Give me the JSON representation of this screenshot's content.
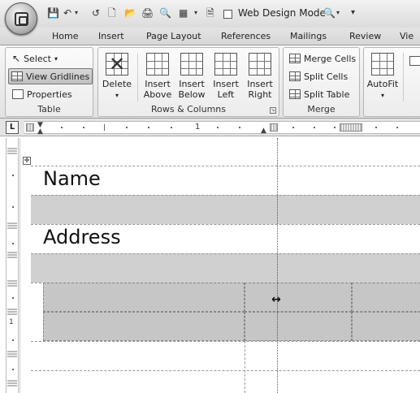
{
  "quick_access": {
    "web_design_mode_label": "Web Design Mode"
  },
  "tabs": [
    "Home",
    "Insert",
    "Page Layout",
    "References",
    "Mailings",
    "Review",
    "Vie"
  ],
  "ribbon": {
    "table_group": {
      "label": "Table",
      "select": "Select",
      "view_gridlines": "View Gridlines",
      "properties": "Properties"
    },
    "rows_columns_group": {
      "label": "Rows & Columns",
      "delete": "Delete",
      "insert_above": [
        "Insert",
        "Above"
      ],
      "insert_below": [
        "Insert",
        "Below"
      ],
      "insert_left": [
        "Insert",
        "Left"
      ],
      "insert_right": [
        "Insert",
        "Right"
      ]
    },
    "merge_group": {
      "label": "Merge",
      "merge_cells": "Merge Cells",
      "split_cells": "Split Cells",
      "split_table": "Split Table"
    },
    "cell_size_group": {
      "autofit": "AutoFit"
    }
  },
  "ruler": {
    "tab_selector": "L",
    "label_1": "1",
    "vertical_label": "1"
  },
  "document": {
    "row_name": "Name",
    "row_address": "Address"
  },
  "icons": {
    "office_button": "office-logo-icon",
    "save": "save-icon",
    "undo": "undo-icon",
    "redo": "redo-icon",
    "new": "new-document-icon",
    "open": "open-icon",
    "print": "print-icon",
    "preview": "print-preview-icon",
    "customize": "customize-qat-icon"
  }
}
